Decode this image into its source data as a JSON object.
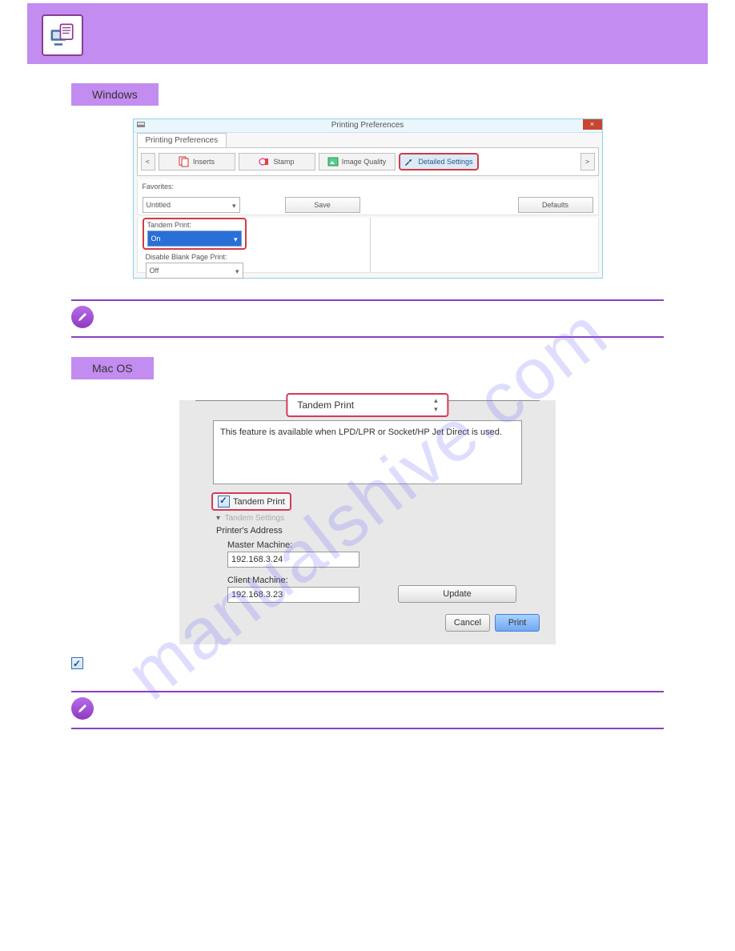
{
  "watermark": "manualshive.com",
  "section_windows": "Windows",
  "section_mac": "Mac OS",
  "note_text": "",
  "win": {
    "dialog_title": "Printing Preferences",
    "tab_label": "Printing Preferences",
    "nav_prev": "<",
    "nav_next": ">",
    "tabs": {
      "inserts": "Inserts",
      "stamp": "Stamp",
      "image_quality": "Image Quality",
      "detailed_settings": "Detailed Settings"
    },
    "favorites_label": "Favorites:",
    "favorites_value": "Untitled",
    "save_button": "Save",
    "defaults_button": "Defaults",
    "tandem_label": "Tandem Print:",
    "tandem_value": "On",
    "blank_label": "Disable Blank Page Print:",
    "blank_value": "Off"
  },
  "mac": {
    "dropdown": "Tandem Print",
    "info_text": "This feature is available when LPD/LPR or Socket/HP Jet Direct is used.",
    "checkbox_label": "Tandem Print",
    "settings_header": "Tandem Settings",
    "printers_address": "Printer's Address",
    "master_label": "Master Machine:",
    "master_value": "192.168.3.24",
    "client_label": "Client Machine:",
    "client_value": "192.168.3.23",
    "update_button": "Update",
    "cancel_button": "Cancel",
    "print_button": "Print"
  }
}
